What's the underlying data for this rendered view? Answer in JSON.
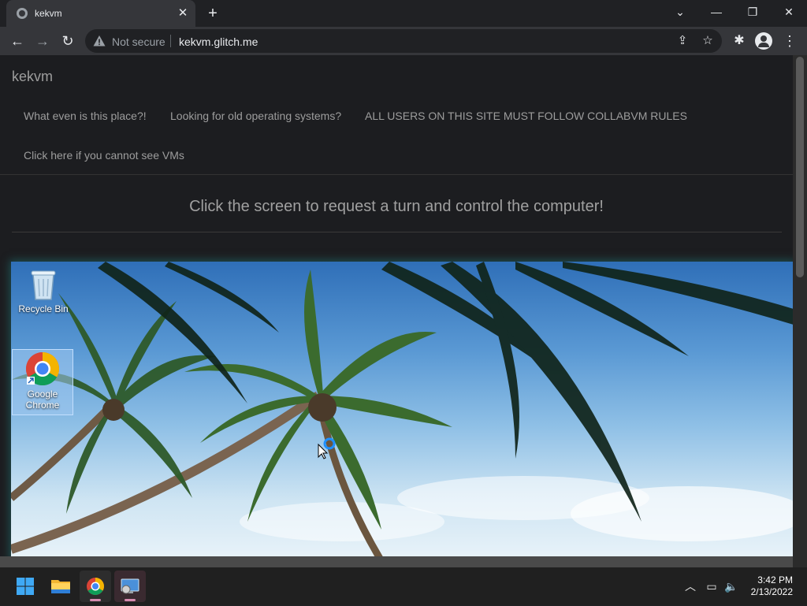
{
  "browser": {
    "tab_title": "kekvm",
    "security_label": "Not secure",
    "url": "kekvm.glitch.me"
  },
  "page": {
    "brand": "kekvm",
    "nav": [
      "What even is this place?!",
      "Looking for old operating systems?",
      "ALL USERS ON THIS SITE MUST FOLLOW COLLABVM RULES",
      "Click here if you cannot see VMs"
    ],
    "headline": "Click the screen to request a turn and control the computer!"
  },
  "vm": {
    "desktop_icons": [
      {
        "label": "Recycle Bin",
        "icon": "recycle-bin-icon"
      },
      {
        "label": "Google Chrome",
        "icon": "chrome-icon"
      }
    ]
  },
  "taskbar": {
    "time": "3:42 PM",
    "date": "2/13/2022",
    "apps": [
      "windows-start-icon",
      "file-explorer-icon",
      "chrome-icon",
      "remote-desktop-icon"
    ]
  },
  "colors": {
    "chrome_dark": "#202124",
    "toolbar": "#35363a",
    "page_bg": "#1c1d20",
    "nav_text": "#9d9d9d",
    "taskbar": "#202020"
  }
}
